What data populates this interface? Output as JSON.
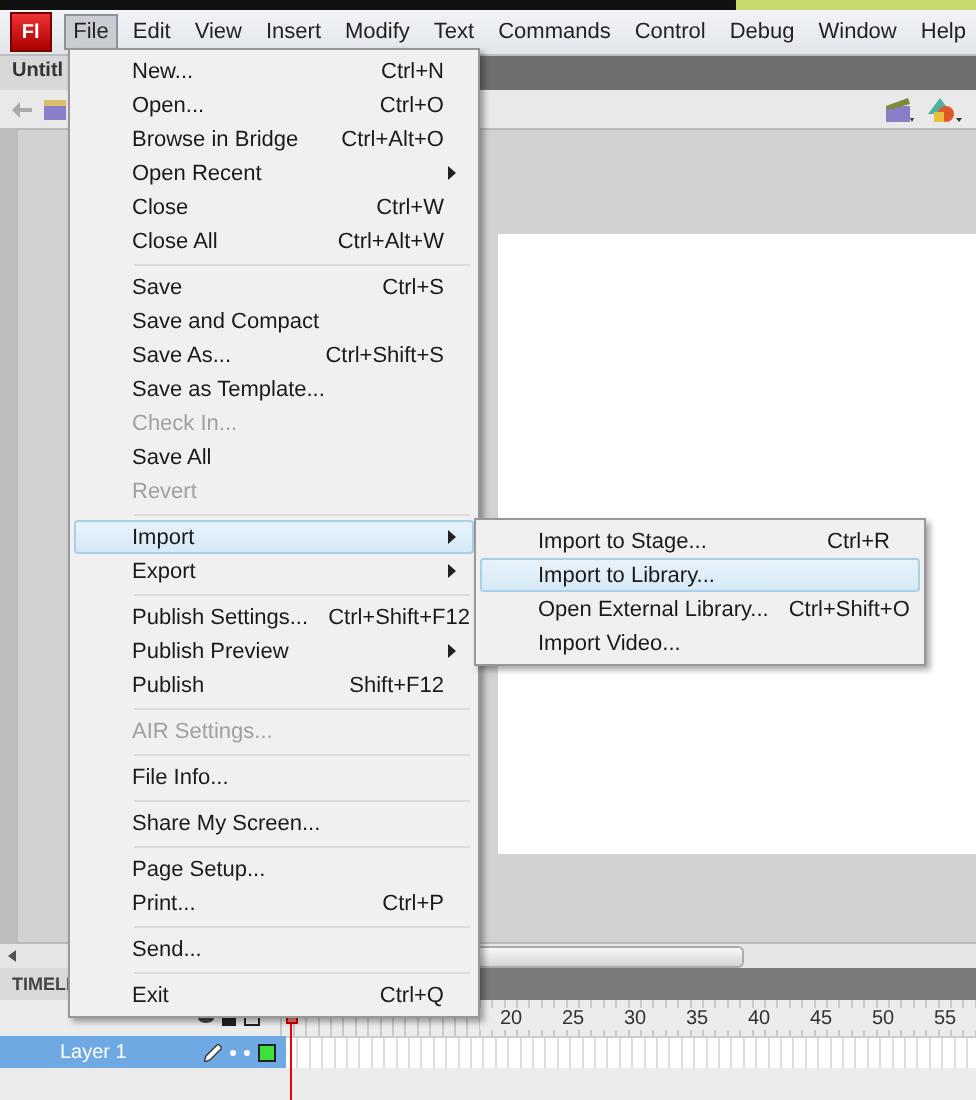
{
  "app": {
    "logo": "Fl"
  },
  "menubar": [
    {
      "label": "File",
      "selected": true
    },
    {
      "label": "Edit",
      "selected": false
    },
    {
      "label": "View",
      "selected": false
    },
    {
      "label": "Insert",
      "selected": false
    },
    {
      "label": "Modify",
      "selected": false
    },
    {
      "label": "Text",
      "selected": false
    },
    {
      "label": "Commands",
      "selected": false
    },
    {
      "label": "Control",
      "selected": false
    },
    {
      "label": "Debug",
      "selected": false
    },
    {
      "label": "Window",
      "selected": false
    },
    {
      "label": "Help",
      "selected": false
    }
  ],
  "document_tab": {
    "label": "Untitl"
  },
  "file_menu": [
    [
      {
        "label": "New...",
        "shortcut": "Ctrl+N",
        "disabled": false,
        "submenu": false,
        "selected": false
      },
      {
        "label": "Open...",
        "shortcut": "Ctrl+O",
        "disabled": false,
        "submenu": false,
        "selected": false
      },
      {
        "label": "Browse in Bridge",
        "shortcut": "Ctrl+Alt+O",
        "disabled": false,
        "submenu": false,
        "selected": false
      },
      {
        "label": "Open Recent",
        "disabled": false,
        "submenu": true,
        "selected": false
      },
      {
        "label": "Close",
        "shortcut": "Ctrl+W",
        "disabled": false,
        "submenu": false,
        "selected": false
      },
      {
        "label": "Close All",
        "shortcut": "Ctrl+Alt+W",
        "disabled": false,
        "submenu": false,
        "selected": false
      }
    ],
    [
      {
        "label": "Save",
        "shortcut": "Ctrl+S",
        "disabled": false,
        "submenu": false,
        "selected": false
      },
      {
        "label": "Save and Compact",
        "disabled": false,
        "submenu": false,
        "selected": false
      },
      {
        "label": "Save As...",
        "shortcut": "Ctrl+Shift+S",
        "disabled": false,
        "submenu": false,
        "selected": false
      },
      {
        "label": "Save as Template...",
        "disabled": false,
        "submenu": false,
        "selected": false
      },
      {
        "label": "Check In...",
        "disabled": true,
        "submenu": false,
        "selected": false
      },
      {
        "label": "Save All",
        "disabled": false,
        "submenu": false,
        "selected": false
      },
      {
        "label": "Revert",
        "disabled": true,
        "submenu": false,
        "selected": false
      }
    ],
    [
      {
        "label": "Import",
        "disabled": false,
        "submenu": true,
        "selected": true
      },
      {
        "label": "Export",
        "disabled": false,
        "submenu": true,
        "selected": false
      }
    ],
    [
      {
        "label": "Publish Settings...",
        "shortcut": "Ctrl+Shift+F12",
        "disabled": false,
        "submenu": false,
        "selected": false
      },
      {
        "label": "Publish Preview",
        "disabled": false,
        "submenu": true,
        "selected": false
      },
      {
        "label": "Publish",
        "shortcut": "Shift+F12",
        "disabled": false,
        "submenu": false,
        "selected": false
      }
    ],
    [
      {
        "label": "AIR Settings...",
        "disabled": true,
        "submenu": false,
        "selected": false
      }
    ],
    [
      {
        "label": "File Info...",
        "disabled": false,
        "submenu": false,
        "selected": false
      }
    ],
    [
      {
        "label": "Share My Screen...",
        "disabled": false,
        "submenu": false,
        "selected": false
      }
    ],
    [
      {
        "label": "Page Setup...",
        "disabled": false,
        "submenu": false,
        "selected": false
      },
      {
        "label": "Print...",
        "shortcut": "Ctrl+P",
        "disabled": false,
        "submenu": false,
        "selected": false
      }
    ],
    [
      {
        "label": "Send...",
        "disabled": false,
        "submenu": false,
        "selected": false
      }
    ],
    [
      {
        "label": "Exit",
        "shortcut": "Ctrl+Q",
        "disabled": false,
        "submenu": false,
        "selected": false
      }
    ]
  ],
  "import_submenu": [
    {
      "label": "Import to Stage...",
      "shortcut": "Ctrl+R",
      "selected": false
    },
    {
      "label": "Import to Library...",
      "selected": true
    },
    {
      "label": "Open External Library...",
      "shortcut": "Ctrl+Shift+O",
      "selected": false
    },
    {
      "label": "Import Video...",
      "selected": false
    }
  ],
  "timeline": {
    "title": "TIMELI",
    "ruler": [
      "20",
      "25",
      "30",
      "35",
      "40",
      "45",
      "50",
      "55"
    ],
    "layers": [
      {
        "name": "Layer 1",
        "selected": true
      }
    ]
  }
}
